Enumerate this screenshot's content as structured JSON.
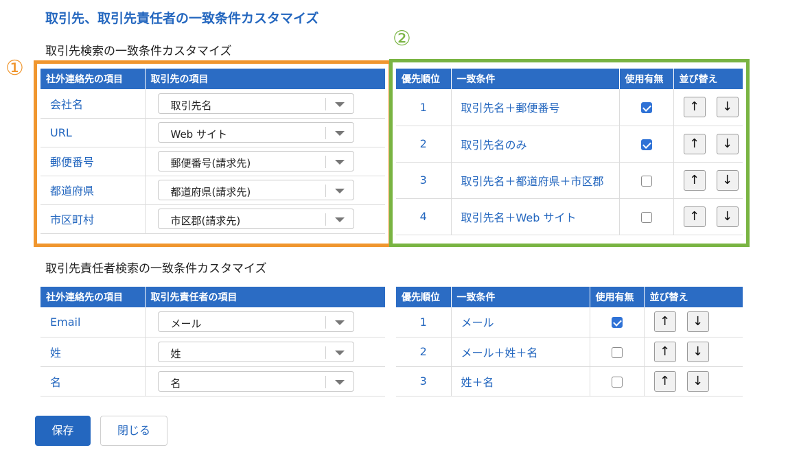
{
  "page_title": "取引先、取引先責任者の一致条件カスタマイズ",
  "markers": {
    "one": "①",
    "two": "②",
    "one_color": "#f0962e",
    "two_color": "#79b442"
  },
  "account": {
    "section_title": "取引先検索の一致条件カスタマイズ",
    "mapping_headers": [
      "社外連絡先の項目",
      "取引先の項目"
    ],
    "mapping_rows": [
      {
        "field": "会社名",
        "value": "取引先名"
      },
      {
        "field": "URL",
        "value": "Web サイト"
      },
      {
        "field": "郵便番号",
        "value": "郵便番号(請求先)"
      },
      {
        "field": "都道府県",
        "value": "都道府県(請求先)"
      },
      {
        "field": "市区町村",
        "value": "市区郡(請求先)"
      }
    ],
    "condition_headers": [
      "優先順位",
      "一致条件",
      "使用有無",
      "並び替え"
    ],
    "condition_rows": [
      {
        "rank": "1",
        "condition": "取引先名＋郵便番号",
        "enabled": true
      },
      {
        "rank": "2",
        "condition": "取引先名のみ",
        "enabled": true
      },
      {
        "rank": "3",
        "condition": "取引先名＋都道府県＋市区郡",
        "enabled": false
      },
      {
        "rank": "4",
        "condition": "取引先名＋Web サイト",
        "enabled": false
      }
    ]
  },
  "contact": {
    "section_title": "取引先責任者検索の一致条件カスタマイズ",
    "mapping_headers": [
      "社外連絡先の項目",
      "取引先責任者の項目"
    ],
    "mapping_rows": [
      {
        "field": "Email",
        "value": "メール"
      },
      {
        "field": "姓",
        "value": "姓"
      },
      {
        "field": "名",
        "value": "名"
      }
    ],
    "condition_headers": [
      "優先順位",
      "一致条件",
      "使用有無",
      "並び替え"
    ],
    "condition_rows": [
      {
        "rank": "1",
        "condition": "メール",
        "enabled": true
      },
      {
        "rank": "2",
        "condition": "メール＋姓＋名",
        "enabled": false
      },
      {
        "rank": "3",
        "condition": "姓＋名",
        "enabled": false
      }
    ]
  },
  "arrows": {
    "up": "↑",
    "down": "↓"
  },
  "buttons": {
    "save": "保存",
    "close": "閉じる"
  },
  "colors": {
    "header": "#2b6cc4",
    "link": "#2467bf",
    "checkbox": "#2f72d6"
  }
}
